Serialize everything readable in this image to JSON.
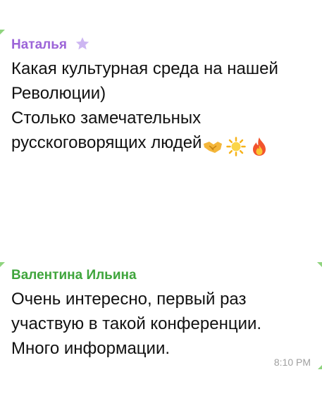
{
  "messages": [
    {
      "sender": "Наталья",
      "sender_color": "#9c64d8",
      "sender_badge_icon": "star-icon",
      "lines": [
        "Какая культурная среда на нашей",
        "Революции)",
        "Столько замечательных",
        "русскоговорящих людей"
      ],
      "trailing_emoji": [
        "handshake-emoji",
        "sun-emoji",
        "fire-emoji"
      ]
    },
    {
      "sender": "Валентина Ильина",
      "sender_color": "#3fa53c",
      "lines": [
        "Очень интересно, первый раз",
        "участвую в такой конференции.",
        "Много информации."
      ],
      "time": "8:10 PM"
    }
  ]
}
